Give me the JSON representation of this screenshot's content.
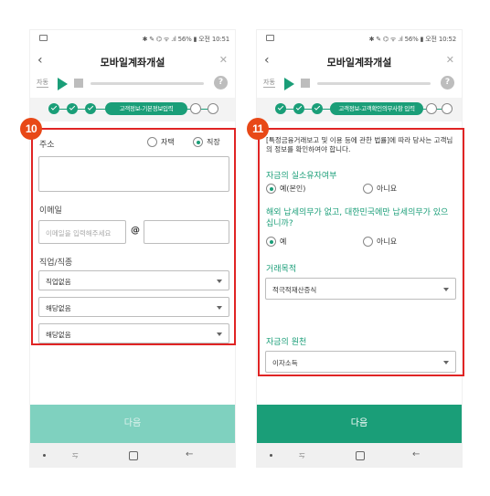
{
  "colors": {
    "accent": "#1a9e78",
    "highlight": "#e02424",
    "badge": "#e84817",
    "disabled_button": "#7fd1bf"
  },
  "left": {
    "status": {
      "time": "✱ ✎ ⌬ ᯤ .ıl 56% ▮ 오전 10:51"
    },
    "header": {
      "title": "모바일계좌개설"
    },
    "audio": {
      "auto_label": "자동"
    },
    "stepper": {
      "current_step": "고객정보-기본정보입력"
    },
    "badge": "10",
    "address": {
      "label": "주소",
      "options": [
        {
          "label": "자택",
          "selected": false
        },
        {
          "label": "직장",
          "selected": true
        }
      ],
      "value": ""
    },
    "email": {
      "label": "이메일",
      "placeholder": "이메일을 입력해주세요",
      "at": "@",
      "domain": ""
    },
    "job": {
      "label": "직업/직종",
      "selects": [
        {
          "value": "직업없음"
        },
        {
          "value": "해당없음"
        },
        {
          "value": "해당없음"
        }
      ]
    },
    "next_button": "다음"
  },
  "right": {
    "status": {
      "time": "✱ ✎ ⌬ ᯤ .ıl 56% ▮ 오전 10:52"
    },
    "header": {
      "title": "모바일계좌개설"
    },
    "audio": {
      "auto_label": "자동"
    },
    "stepper": {
      "current_step": "고객정보-고객확인의무사항 입력"
    },
    "badge": "11",
    "notice": "[특정금융거래보고 및 이용 등에 관한 법률]에 따라 당사는 고객님의 정보를 확인하여야 합니다.",
    "owner": {
      "label": "자금의 실소유자여부",
      "options": [
        {
          "label": "예(본인)",
          "selected": true
        },
        {
          "label": "아니요",
          "selected": false
        }
      ]
    },
    "tax": {
      "label": "해외 납세의무가 없고, 대한민국에만 납세의무가 있으십니까?",
      "options": [
        {
          "label": "예",
          "selected": true
        },
        {
          "label": "아니요",
          "selected": false
        }
      ]
    },
    "purpose": {
      "label": "거래목적",
      "value": "적극적재산증식"
    },
    "source": {
      "label": "자금의 원천",
      "value": "이자소득"
    },
    "next_button": "다음"
  }
}
